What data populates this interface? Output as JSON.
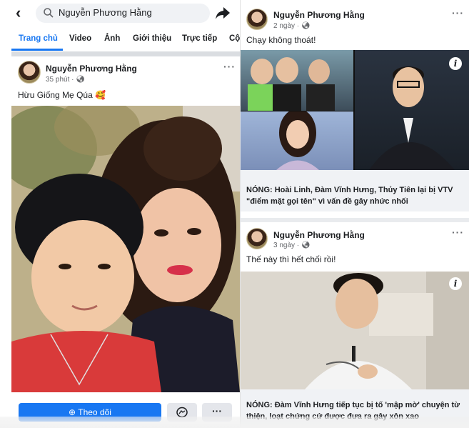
{
  "left": {
    "search": {
      "query": "Nguyễn Phương Hằng"
    },
    "tabs": [
      {
        "label": "Trang chủ",
        "active": true
      },
      {
        "label": "Video"
      },
      {
        "label": "Ảnh"
      },
      {
        "label": "Giới thiệu"
      },
      {
        "label": "Trực tiếp"
      },
      {
        "label": "Cộ"
      }
    ],
    "post": {
      "author": "Nguyễn Phương Hằng",
      "meta": "35 phút · ",
      "text": "Hừu Giống Mẹ Qúa 🥰"
    },
    "actions": {
      "follow_label": "Theo dõi",
      "more_label": "···"
    }
  },
  "right": {
    "post1": {
      "author": "Nguyễn Phương Hằng",
      "meta": "2 ngày · ",
      "text": "Chạy không thoát!",
      "link_title": "NÓNG: Hoài Linh, Đàm Vĩnh Hưng, Thủy Tiên lại bị VTV \"điểm mặt gọi tên\" vì vấn đề gây nhức nhối"
    },
    "post2": {
      "author": "Nguyễn Phương Hằng",
      "meta": "3 ngày · ",
      "text": "Thế này thì hết chối rồi!",
      "link_title": "NÓNG: Đàm Vĩnh Hưng tiếp tục bị tố 'mập mờ' chuyện từ thiện, loạt chứng cứ được đưa ra gây xôn xao"
    }
  },
  "colors": {
    "accent": "#1877f2",
    "text": "#1c1e21",
    "muted": "#65676b"
  },
  "icons": [
    "back-arrow-icon",
    "search-icon",
    "share-icon",
    "globe-icon",
    "more-icon",
    "info-icon",
    "messenger-icon",
    "follow-icon"
  ]
}
